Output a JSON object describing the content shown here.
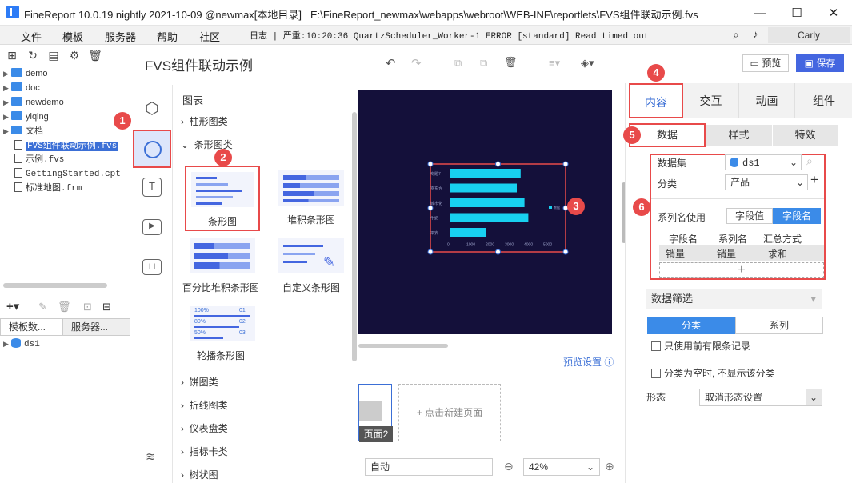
{
  "window": {
    "title": "FineReport 10.0.19 nightly 2021-10-09 @newmax[本地目录]",
    "path": "E:\\FineReport_newmax\\webapps\\webroot\\WEB-INF\\reportlets\\FVS组件联动示例.fvs",
    "min": "—",
    "max": "☐",
    "close": "✕"
  },
  "menu": {
    "items": [
      "文件",
      "模板",
      "服务器",
      "帮助",
      "社区"
    ],
    "log": "日志 | 严重:10:20:36 QuartzScheduler_Worker-1 ERROR [standard] Read timed out",
    "user": "Carly"
  },
  "tree": {
    "folders": [
      "demo",
      "doc",
      "newdemo",
      "yiqing",
      "文档"
    ],
    "files": [
      "FVS组件联动示例.fvs",
      "示例.fvs",
      "GettingStarted.cpt",
      "标准地图.frm"
    ],
    "tabs": [
      "模板数...",
      "服务器..."
    ],
    "datasource": "ds1"
  },
  "editor": {
    "title": "FVS组件联动示例",
    "preview": "预览",
    "save": "保存"
  },
  "chartmenu": {
    "header": "图表",
    "cats_top": [
      "柱形图类",
      "条形图类"
    ],
    "thumbs": [
      "条形图",
      "堆积条形图",
      "百分比堆积条形图",
      "自定义条形图",
      "轮播条形图"
    ],
    "carousel_vals": [
      "100%",
      "80%",
      "50%"
    ],
    "carousel_idx": [
      "01",
      "02",
      "03"
    ],
    "cats_bottom": [
      "饼图类",
      "折线图类",
      "仪表盘类",
      "指标卡类",
      "树状图"
    ]
  },
  "chart_data": {
    "type": "bar",
    "categories": [
      "专题7",
      "京东方",
      "城市化",
      "牛奶",
      "平安"
    ],
    "values": [
      3700,
      3500,
      3900,
      4100,
      1900
    ],
    "ticks": [
      "0",
      "1000",
      "2000",
      "3000",
      "4000",
      "5000"
    ],
    "legend": "数据",
    "xlim": [
      0,
      5000
    ],
    "color": "#18d0f0"
  },
  "pages": {
    "preview_settings": "预览设置",
    "page2": "页面2",
    "new_page": "+ 点击新建页面",
    "auto": "自动",
    "zoom": "42%"
  },
  "right": {
    "tabs": [
      "内容",
      "交互",
      "动画",
      "组件"
    ],
    "subtabs": [
      "数据",
      "样式",
      "特效"
    ],
    "dataset_label": "数据集",
    "dataset": "ds1",
    "category_label": "分类",
    "category": "产品",
    "series_label": "系列名使用",
    "seg_value": "字段值",
    "seg_name": "字段名",
    "cols": [
      "字段名",
      "系列名",
      "汇总方式"
    ],
    "row": [
      "销量",
      "销量",
      "求和"
    ],
    "filter": "数据筛选",
    "filter_tabs": [
      "分类",
      "系列"
    ],
    "check1": "只使用前有限条记录",
    "check2": "分类为空时, 不显示该分类",
    "form_label": "形态",
    "form_value": "取消形态设置"
  },
  "badges": [
    "1",
    "2",
    "3",
    "4",
    "5",
    "6"
  ],
  "colors": {
    "accent": "#3b8be8",
    "highlight": "#e84a4a",
    "canvas": "#14103a"
  }
}
